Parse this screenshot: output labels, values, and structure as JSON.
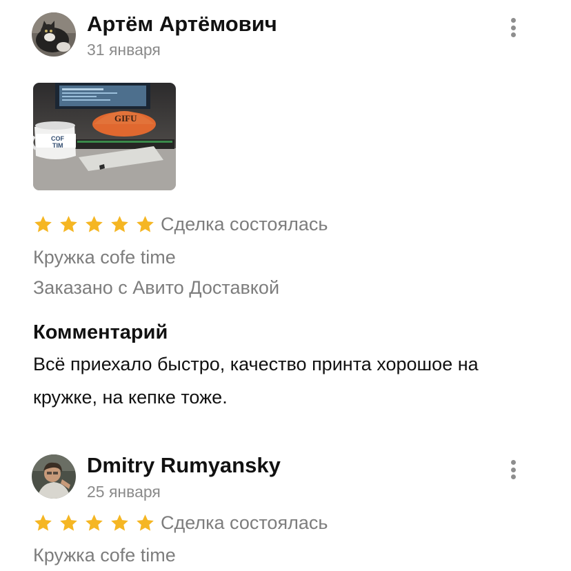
{
  "reviews": [
    {
      "author": "Артём Артёмович",
      "date": "31 января",
      "rating": 5,
      "status": "Сделка состоялась",
      "item": "Кружка cofe time",
      "delivery": "Заказано с Авито Доставкой",
      "photo_text": {
        "mug_line1": "COF",
        "mug_line2": "TIM",
        "cap": "GIFU"
      },
      "comment_title": "Комментарий",
      "comment": "Всё приехало быстро, качество принта хорошое на кружке, на кепке тоже."
    },
    {
      "author": "Dmitry Rumyansky",
      "date": "25 января",
      "rating": 5,
      "status": "Сделка состоялась",
      "item": "Кружка cofe time"
    }
  ],
  "colors": {
    "star": "#f5b623",
    "secondary_text": "#7d7d7d",
    "menu_dots": "#8e8e8e"
  },
  "icons": {
    "menu": "more-vertical-icon",
    "rating": "star-icon"
  }
}
